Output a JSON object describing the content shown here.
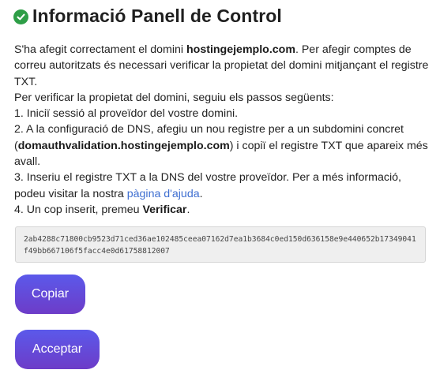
{
  "header": {
    "icon": "check-circle-icon",
    "title": "Informació Panell de Control"
  },
  "message": {
    "p1_a": "S'ha afegit correctament el domini ",
    "domain": "hostingejemplo.com",
    "p1_b": ". Per afegir comptes de correu autoritzats és necessari verificar la propietat del domini mitjançant el registre TXT.",
    "p2": "Per verificar la propietat del domini, seguiu els passos següents:",
    "step1": "1. Iniciï sessió al proveïdor del vostre domini.",
    "step2_a": "2. A la configuració de DNS, afegiu un nou registre per a un subdomini concret (",
    "subdomain": "domauthvalidation.hostingejemplo.com",
    "step2_b": ") i copiï el registre TXT que apareix més avall.",
    "step3_a": "3. Inseriu el registre TXT a la DNS del vostre proveïdor. Per a més informació, podeu visitar la nostra ",
    "help_link": "pàgina d'ajuda",
    "step3_b": ".",
    "step4_a": "4. Un cop inserit, premeu ",
    "verify_word": "Verificar",
    "step4_b": "."
  },
  "txt_record": "2ab4288c71800cb9523d71ced36ae102485ceea07162d7ea1b3684c0ed150d636158e9e440652b17349041f49bb667106f5facc4e0d61758812007",
  "buttons": {
    "copy_label": "Copiar",
    "accept_label": "Acceptar"
  },
  "colors": {
    "check_icon": "#2e9e47",
    "link": "#3f6fd1",
    "button_top": "#5b59ea",
    "button_bottom": "#6d3cc8"
  }
}
